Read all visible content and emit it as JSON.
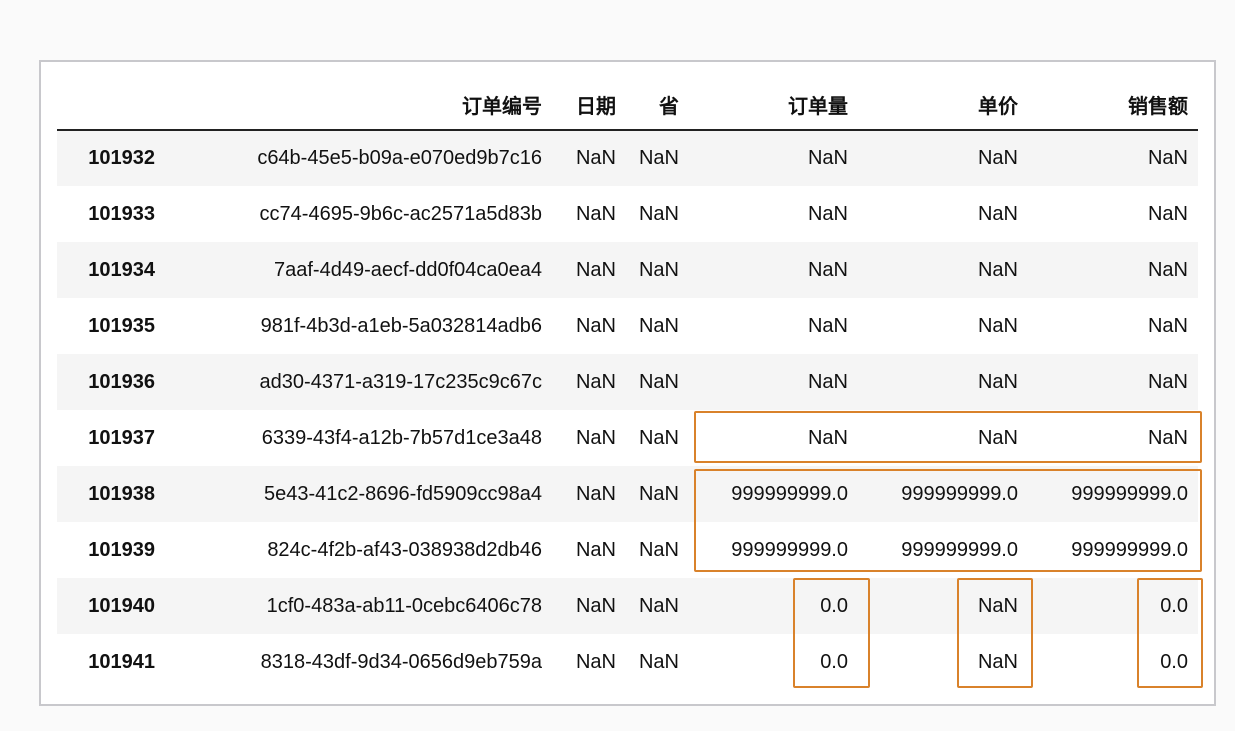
{
  "table": {
    "columns": [
      "",
      "订单编号",
      "日期",
      "省",
      "订单量",
      "单价",
      "销售额"
    ],
    "rows": [
      {
        "index": "101932",
        "order_id": "c64b-45e5-b09a-e070ed9b7c16",
        "date": "NaN",
        "province": "NaN",
        "quantity": "NaN",
        "unit_price": "NaN",
        "sales": "NaN"
      },
      {
        "index": "101933",
        "order_id": "cc74-4695-9b6c-ac2571a5d83b",
        "date": "NaN",
        "province": "NaN",
        "quantity": "NaN",
        "unit_price": "NaN",
        "sales": "NaN"
      },
      {
        "index": "101934",
        "order_id": "7aaf-4d49-aecf-dd0f04ca0ea4",
        "date": "NaN",
        "province": "NaN",
        "quantity": "NaN",
        "unit_price": "NaN",
        "sales": "NaN"
      },
      {
        "index": "101935",
        "order_id": "981f-4b3d-a1eb-5a032814adb6",
        "date": "NaN",
        "province": "NaN",
        "quantity": "NaN",
        "unit_price": "NaN",
        "sales": "NaN"
      },
      {
        "index": "101936",
        "order_id": "ad30-4371-a319-17c235c9c67c",
        "date": "NaN",
        "province": "NaN",
        "quantity": "NaN",
        "unit_price": "NaN",
        "sales": "NaN"
      },
      {
        "index": "101937",
        "order_id": "6339-43f4-a12b-7b57d1ce3a48",
        "date": "NaN",
        "province": "NaN",
        "quantity": "NaN",
        "unit_price": "NaN",
        "sales": "NaN"
      },
      {
        "index": "101938",
        "order_id": "5e43-41c2-8696-fd5909cc98a4",
        "date": "NaN",
        "province": "NaN",
        "quantity": "999999999.0",
        "unit_price": "999999999.0",
        "sales": "999999999.0"
      },
      {
        "index": "101939",
        "order_id": "824c-4f2b-af43-038938d2db46",
        "date": "NaN",
        "province": "NaN",
        "quantity": "999999999.0",
        "unit_price": "999999999.0",
        "sales": "999999999.0"
      },
      {
        "index": "101940",
        "order_id": "1cf0-483a-ab11-0cebc6406c78",
        "date": "NaN",
        "province": "NaN",
        "quantity": "0.0",
        "unit_price": "NaN",
        "sales": "0.0"
      },
      {
        "index": "101941",
        "order_id": "8318-43df-9d34-0656d9eb759a",
        "date": "NaN",
        "province": "NaN",
        "quantity": "0.0",
        "unit_price": "NaN",
        "sales": "0.0"
      }
    ]
  },
  "colors": {
    "highlight": "#d9822b",
    "frame_border": "#c8c8cc",
    "stripe": "#f5f5f5"
  }
}
